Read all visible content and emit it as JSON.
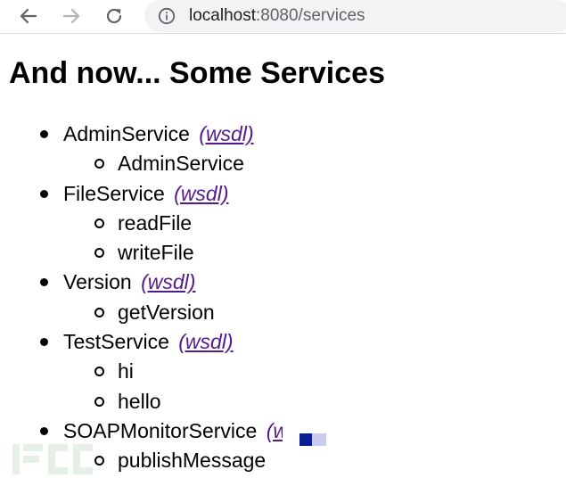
{
  "browser": {
    "url_host": "localhost",
    "url_rest": ":8080/services",
    "icons": {
      "back": "arrow-left-icon",
      "forward": "arrow-right-icon",
      "reload": "reload-icon",
      "info": "info-circle-icon"
    }
  },
  "page": {
    "title": "And now... Some Services",
    "wsdl_label": "(wsdl)",
    "services": [
      {
        "name": "AdminService",
        "operations": [
          "AdminService"
        ]
      },
      {
        "name": "FileService",
        "operations": [
          "readFile",
          "writeFile"
        ]
      },
      {
        "name": "Version",
        "operations": [
          "getVersion"
        ]
      },
      {
        "name": "TestService",
        "operations": [
          "hi",
          "hello"
        ]
      },
      {
        "name": "SOAPMonitorService",
        "operations": [
          "publishMessage"
        ]
      }
    ]
  },
  "colors": {
    "link_visited": "#551a8b",
    "omnibox_bg": "#f1f3f4",
    "url_secondary": "#5f6368"
  }
}
